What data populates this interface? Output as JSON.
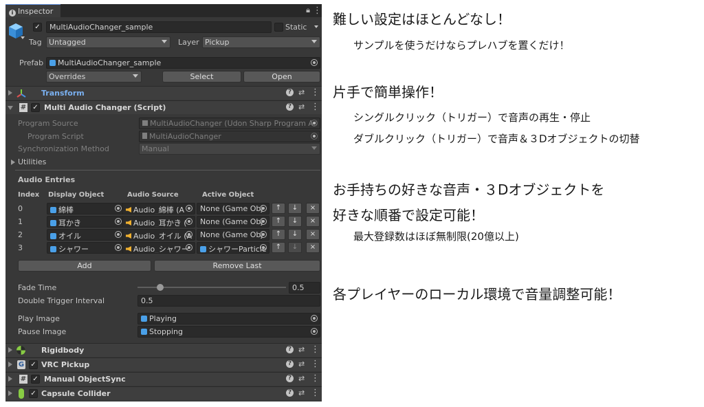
{
  "inspector": {
    "tab_label": "Inspector",
    "object": {
      "name": "MultiAudioChanger_sample",
      "static_label": "Static",
      "tag_label": "Tag",
      "tag_value": "Untagged",
      "layer_label": "Layer",
      "layer_value": "Pickup",
      "prefab_label": "Prefab",
      "prefab_value": "MultiAudioChanger_sample",
      "overrides_label": "Overrides",
      "select_label": "Select",
      "open_label": "Open"
    },
    "components": {
      "transform": "Transform",
      "script": "Multi Audio Changer (Script)",
      "rigidbody": "Rigidbody",
      "vrc_pickup": "VRC Pickup",
      "manual_sync": "Manual ObjectSync",
      "capsule": "Capsule Collider"
    },
    "script": {
      "program_source_label": "Program Source",
      "program_source_value": "MultiAudioChanger (Udon Sharp Program As",
      "program_script_label": "Program Script",
      "program_script_value": "MultiAudioChanger",
      "sync_label": "Synchronization Method",
      "sync_value": "Manual",
      "utilities_label": "Utilities",
      "entries_title": "Audio Entries",
      "columns": [
        "Index",
        "Display Object",
        "Audio Source",
        "Active Object"
      ],
      "entries": [
        {
          "index": "0",
          "display": "綿棒",
          "audio": "Audio_綿棒 (A",
          "active": "None (Game Obj"
        },
        {
          "index": "1",
          "display": "耳かき",
          "audio": "Audio_耳かき (",
          "active": "None (Game Obj"
        },
        {
          "index": "2",
          "display": "オイル",
          "audio": "Audio_オイル (A",
          "active": "None (Game Obj"
        },
        {
          "index": "3",
          "display": "シャワー",
          "audio": "Audio_シャワー",
          "active": "シャワーParticle"
        }
      ],
      "up_symbol": "↑",
      "down_symbol": "↓",
      "remove_symbol": "×",
      "add_label": "Add",
      "remove_last_label": "Remove Last",
      "fade_time_label": "Fade Time",
      "fade_time_value": "0.5",
      "fade_time_fraction": 0.05,
      "double_trigger_label": "Double Trigger Interval",
      "double_trigger_value": "0.5",
      "play_image_label": "Play Image",
      "play_image_value": "Playing",
      "pause_image_label": "Pause Image",
      "pause_image_value": "Stopping"
    }
  },
  "notes": {
    "h1": "難しい設定はほとんどなし！",
    "s1": "サンプルを使うだけならプレハブを置くだけ！",
    "h2": "片手で簡単操作！",
    "s2a": "シングルクリック（トリガー）で音声の再生・停止",
    "s2b": "ダブルクリック（トリガー）で音声＆３Dオブジェクトの切替",
    "h3a": "お手持ちの好きな音声・３Dオブジェクトを",
    "h3b": "好きな順番で設定可能！",
    "s3": "最大登録数はほぼ無制限(20億以上)",
    "h4": "各プレイヤーのローカル環境で音量調整可能！"
  },
  "colors": {
    "panel_bg": "#383838",
    "accent_blue": "#4aa0e8",
    "audio_icon": "#f0b030",
    "transform_icon_red": "#e05050",
    "rigidbody_green": "#88cc44"
  }
}
